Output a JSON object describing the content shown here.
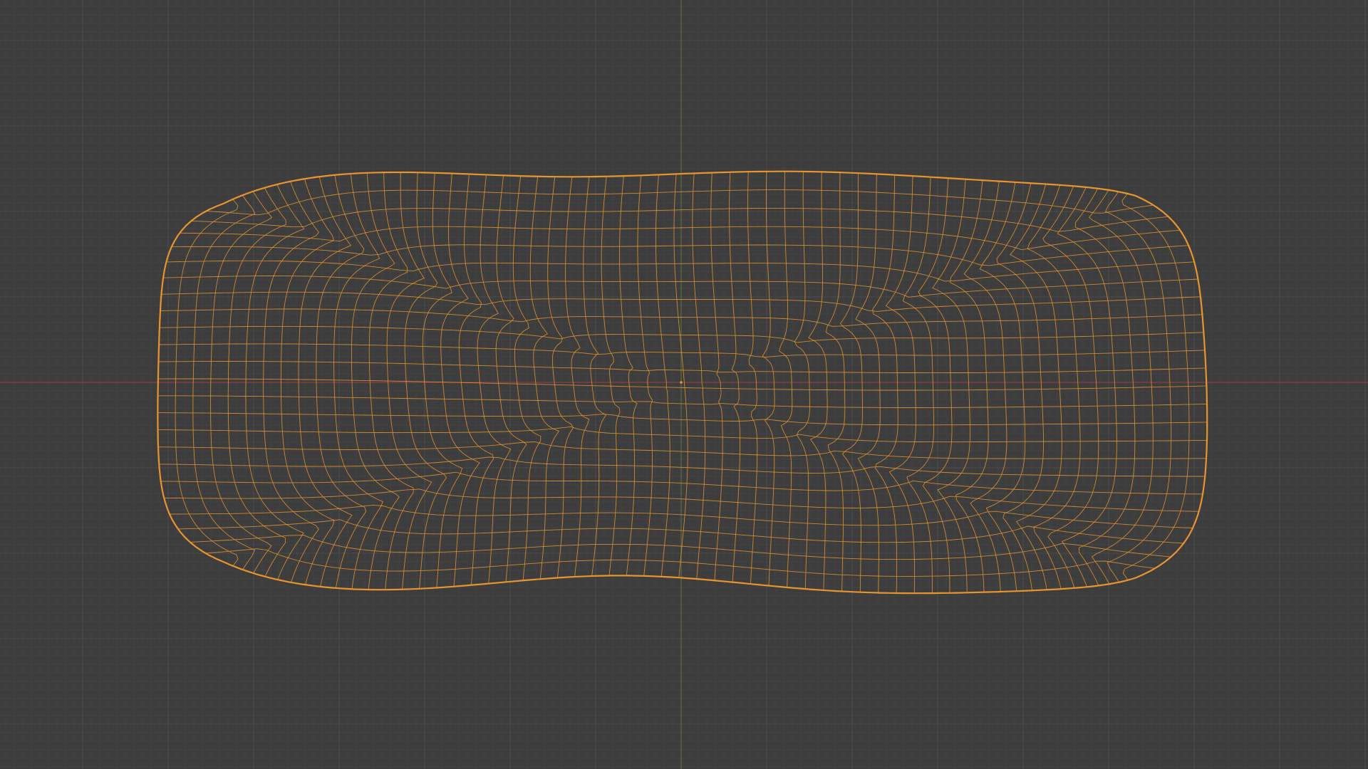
{
  "viewport": {
    "background_color": "#3d3d3d",
    "grid_minor_color": "#444444",
    "grid_major_color": "#4c4c4c",
    "x_axis_color": "#8a3f46",
    "y_axis_color": "#5b6b3a",
    "selection_color": "#e8952f",
    "origin_icon": "object-origin-dot",
    "mesh_name_icon": "wireframe-mesh",
    "mesh_mode": "wireframe",
    "mesh_selected": true
  }
}
